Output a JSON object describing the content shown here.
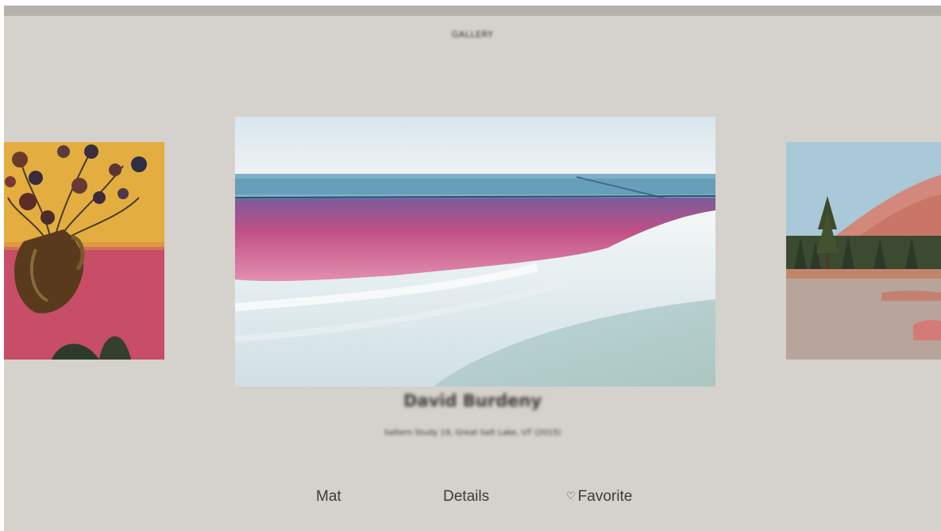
{
  "header": {
    "title": "GALLERY"
  },
  "artworks": {
    "previous": {
      "name": "Still life with flowers"
    },
    "current": {
      "name": "Salt lake landscape"
    },
    "next": {
      "name": "Mountain landscape"
    }
  },
  "info": {
    "artist": "David Burdeny",
    "title": "Saltern Study 19, Great Salt Lake, UT (2015)"
  },
  "menu": {
    "mat_label": "Mat",
    "details_label": "Details",
    "favorite_icon": "♡",
    "favorite_label": "Favorite"
  },
  "colors": {
    "background": "#d5d1cc",
    "top_bar": "#b5b2ad",
    "text": "#3c3c3c"
  }
}
